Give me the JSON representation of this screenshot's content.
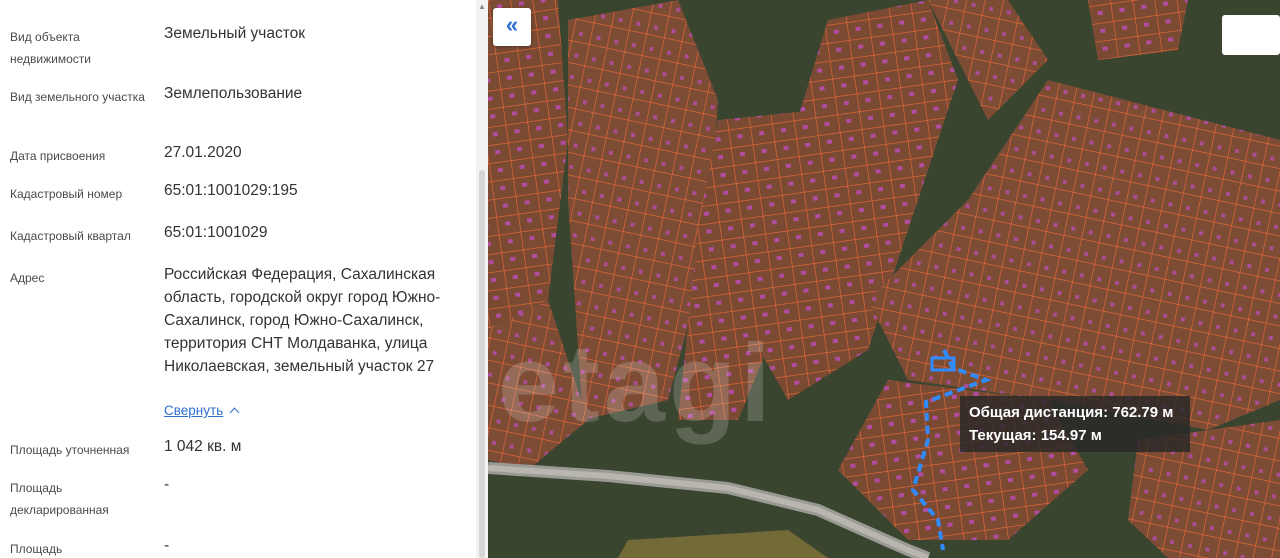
{
  "properties": [
    {
      "label": "Вид объекта недвижимости",
      "value": "Земельный участок"
    },
    {
      "label": "Вид земельного участка",
      "value": "Землепользование"
    },
    {
      "label": "Дата присвоения",
      "value": "27.01.2020"
    },
    {
      "label": "Кадастровый номер",
      "value": "65:01:1001029:195"
    },
    {
      "label": "Кадастровый квартал",
      "value": "65:01:1001029"
    },
    {
      "label": "Адрес",
      "value": "Российская Федерация, Сахалинская область, городской округ город Южно-Сахалинск, город Южно-Сахалинск, территория СНТ Молдаванка, улица Николаевская, земельный участок 27"
    },
    {
      "label": "Площадь уточненная",
      "value": "1 042 кв. м"
    },
    {
      "label": "Площадь декларированная",
      "value": "-"
    },
    {
      "label": "Площадь",
      "value": "-"
    }
  ],
  "collapse_label": "Свернуть",
  "map": {
    "collapse_button": "«",
    "watermark": "etagi",
    "tooltip": {
      "total": "Общая дистанция: 762.79 м",
      "current": "Текущая: 154.97 м"
    }
  },
  "colors": {
    "parcel_line": "#e8663c",
    "route": "#2f8cff",
    "link": "#2e6fd1"
  }
}
